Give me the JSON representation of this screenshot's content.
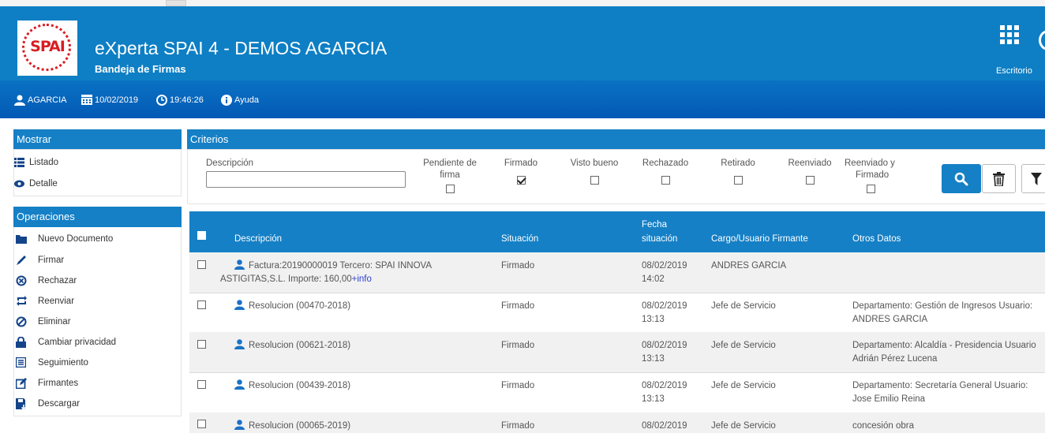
{
  "app": {
    "title": "eXperta SPAI 4 - DEMOS AGARCIA",
    "subtitle": "Bandeja de Firmas",
    "logo_text": "SPAI",
    "desktop_label": "Escritorio"
  },
  "infobar": {
    "user": "AGARCIA",
    "date": "10/02/2019",
    "time": "19:46:26",
    "help": "Ayuda"
  },
  "mostrar": {
    "title": "Mostrar",
    "items": [
      "Listado",
      "Detalle"
    ]
  },
  "operaciones": {
    "title": "Operaciones",
    "items": [
      "Nuevo Documento",
      "Firmar",
      "Rechazar",
      "Reenviar",
      "Eliminar",
      "Cambiar privacidad",
      "Seguimiento",
      "Firmantes",
      "Descargar"
    ]
  },
  "criterios": {
    "title": "Criterios",
    "descripcion_label": "Descripción",
    "descripcion_value": "",
    "pendiente": {
      "label1": "Pendiente de",
      "label2": "firma",
      "checked": false
    },
    "firmado": {
      "label": "Firmado",
      "checked": true
    },
    "visto": {
      "label": "Visto bueno",
      "checked": false
    },
    "rechazado": {
      "label": "Rechazado",
      "checked": false
    },
    "retirado": {
      "label": "Retirado",
      "checked": false
    },
    "reenviado": {
      "label": "Reenviado",
      "checked": false
    },
    "reenviado_firmado": {
      "label1": "Reenviado y",
      "label2": "Firmado",
      "checked": false
    }
  },
  "table": {
    "headers": {
      "descripcion": "Descripción",
      "situacion": "Situación",
      "fecha1": "Fecha",
      "fecha2": "situación",
      "cargo": "Cargo/Usuario Firmante",
      "otros": "Otros Datos"
    },
    "rows": [
      {
        "desc1": "Factura:20190000019 Tercero: SPAI INNOVA",
        "desc2": "ASTIGITAS,S.L. Importe: 160,00",
        "more": "+info",
        "situacion": "Firmado",
        "fecha": "08/02/2019",
        "hora": "14:02",
        "cargo": "ANDRES GARCIA",
        "otros1": "",
        "otros2": ""
      },
      {
        "desc1": "Resolucion (00470-2018)",
        "situacion": "Firmado",
        "fecha": "08/02/2019",
        "hora": "13:13",
        "cargo": "Jefe de Servicio",
        "otros1": "Departamento: Gestión de Ingresos Usuario:",
        "otros2": "ANDRES GARCIA"
      },
      {
        "desc1": "Resolucion (00621-2018)",
        "situacion": "Firmado",
        "fecha": "08/02/2019",
        "hora": "13:13",
        "cargo": "Jefe de Servicio",
        "otros1": "Departamento: Alcaldía - Presidencia Usuario",
        "otros2": "Adrián Pérez Lucena"
      },
      {
        "desc1": "Resolucion (00439-2018)",
        "situacion": "Firmado",
        "fecha": "08/02/2019",
        "hora": "13:13",
        "cargo": "Jefe de Servicio",
        "otros1": "Departamento: Secretaría General Usuario:",
        "otros2": "Jose Emilio Reina"
      },
      {
        "desc1": "Resolucion (00065-2019)",
        "situacion": "Firmado",
        "fecha": "08/02/2019",
        "hora": "",
        "cargo": "Jefe de Servicio",
        "otros1": "concesión obra",
        "otros2": ""
      }
    ]
  },
  "colors": {
    "header": "#0e7fc4",
    "infobar": "#0359b5",
    "panel": "#1580c6",
    "brand_red": "#d91d23",
    "link": "#2f3fd0"
  }
}
